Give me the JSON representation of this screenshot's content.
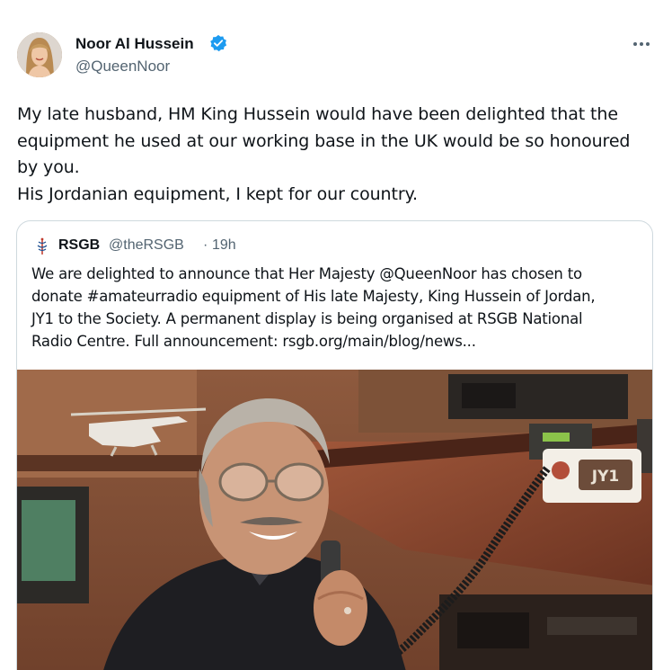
{
  "tweet": {
    "author_name": "Noor Al Hussein",
    "author_handle": "@QueenNoor",
    "verified_icon": "verified-badge-icon",
    "more_icon": "more-options-icon",
    "text_lines": [
      "My late husband, HM King Hussein would have been delighted that the",
      "equipment he used at our working base in the UK would be so honoured",
      "by you.",
      "His Jordanian equipment, I kept for our country."
    ]
  },
  "quoted": {
    "name": "RSGB",
    "handle": "@theRSGB",
    "separator": "·",
    "time": "19h",
    "icon": "rsgb-logo-icon",
    "text_lines": [
      "We are delighted to announce that Her Majesty @QueenNoor has chosen to",
      "donate #amateurradio equipment of His late Majesty, King Hussein of Jordan,",
      "JY1 to the Society. A permanent display is being organised at RSGB National",
      "Radio Centre. Full announcement: rsgb.org/main/blog/news..."
    ],
    "photo_label": "JY1"
  },
  "colors": {
    "text": "#0f1419",
    "secondary": "#536471",
    "verified": "#1d9bf0",
    "border": "#cfd9de"
  }
}
